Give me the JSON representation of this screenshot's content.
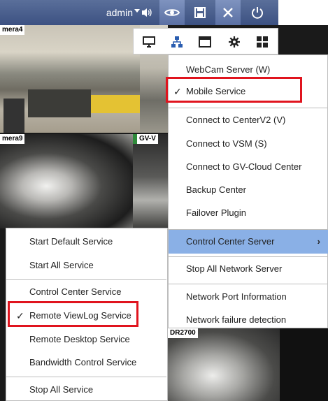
{
  "toolbar": {
    "user": "admin",
    "accent": "#3c5182",
    "icons": [
      "volume-icon",
      "eye-icon",
      "save-icon",
      "tools-icon",
      "power-icon"
    ]
  },
  "cameras": {
    "cam4": "mera4",
    "cam9": "mera9",
    "gv": "GV-V",
    "r2700": "DR2700"
  },
  "iconbar": {
    "icons": [
      "monitor-icon",
      "network-icon",
      "window-icon",
      "gear-icon",
      "grid-icon"
    ]
  },
  "menu_right": {
    "items": [
      {
        "label": "WebCam Server (W)",
        "checked": false
      },
      {
        "label": "Mobile Service",
        "checked": true
      },
      {
        "label": "Connect to CenterV2 (V)",
        "checked": false
      },
      {
        "label": "Connect to VSM (S)",
        "checked": false
      },
      {
        "label": "Connect to GV-Cloud Center",
        "checked": false
      },
      {
        "label": "Backup Center",
        "checked": false
      },
      {
        "label": "Failover Plugin",
        "checked": false
      },
      {
        "label": "Control Center Server",
        "checked": false,
        "submenu": true,
        "highlighted": true
      },
      {
        "label": "Stop All Network Server",
        "checked": false
      },
      {
        "label": "Network Port Information",
        "checked": false
      },
      {
        "label": "Network failure detection",
        "checked": false
      }
    ]
  },
  "menu_left": {
    "items": [
      {
        "label": "Start Default Service",
        "checked": false
      },
      {
        "label": "Start All Service",
        "checked": false
      },
      {
        "label": "Control Center Service",
        "checked": false
      },
      {
        "label": "Remote ViewLog Service",
        "checked": true
      },
      {
        "label": "Remote Desktop Service",
        "checked": false
      },
      {
        "label": "Bandwidth Control Service",
        "checked": false
      },
      {
        "label": "Stop All Service",
        "checked": false
      }
    ]
  },
  "colors": {
    "highlight": "#8ab0e6",
    "annotation_red": "#e0141e"
  }
}
